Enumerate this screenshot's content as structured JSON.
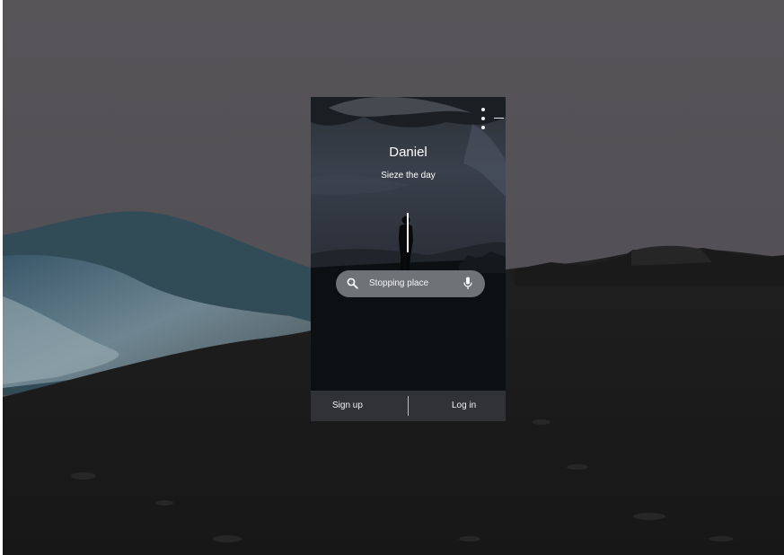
{
  "profile": {
    "name": "Daniel",
    "tagline": "Sieze the day"
  },
  "search": {
    "value": "Stopping place",
    "icon": "search-icon",
    "voice_icon": "mic-icon"
  },
  "window_controls": {
    "menu_icon": "more-vertical-icon",
    "minimize_icon": "minimize-icon"
  },
  "auth": {
    "signup_label": "Sign up",
    "login_label": "Log in"
  },
  "colors": {
    "backdrop": "#575457",
    "card": "#111519",
    "search_field": "#7d8084",
    "auth_bar": "#313235",
    "text": "#ffffff"
  }
}
